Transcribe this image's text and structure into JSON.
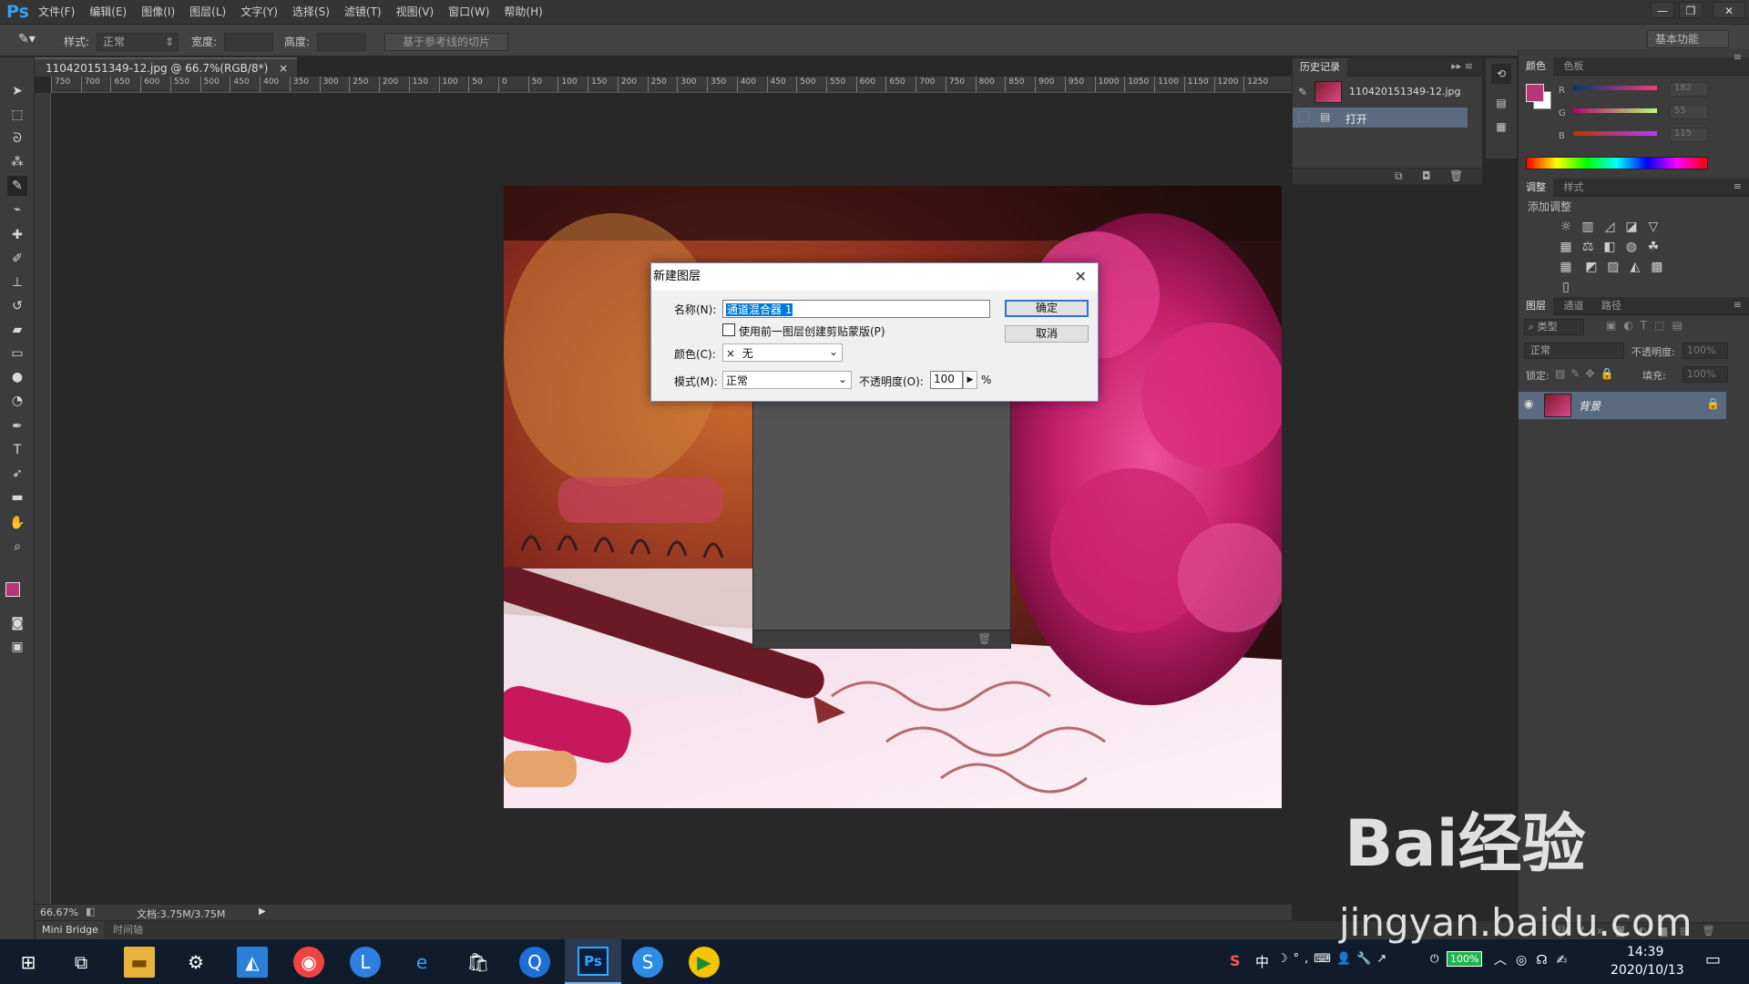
{
  "app": {
    "logo": "Ps"
  },
  "menus": [
    "文件(F)",
    "编辑(E)",
    "图像(I)",
    "图层(L)",
    "文字(Y)",
    "选择(S)",
    "滤镜(T)",
    "视图(V)",
    "窗口(W)",
    "帮助(H)"
  ],
  "window_controls": {
    "minimize": "—",
    "restore": "❐",
    "close": "✕"
  },
  "options_bar": {
    "style_label": "样式:",
    "style_value": "正常",
    "width_label": "宽度:",
    "height_label": "高度:",
    "slice_button": "基于参考线的切片",
    "workspace": "基本功能"
  },
  "document": {
    "tab_title": "110420151349-12.jpg @ 66.7%(RGB/8*)",
    "tab_close": "×",
    "zoom": "66.67%",
    "doc_size": "文档:3.75M/3.75M"
  },
  "ruler": {
    "h_ticks": [
      "750",
      "700",
      "650",
      "600",
      "550",
      "500",
      "450",
      "400",
      "350",
      "300",
      "250",
      "200",
      "150",
      "100",
      "50",
      "0",
      "50",
      "100",
      "150",
      "200",
      "250",
      "300",
      "350",
      "400",
      "450",
      "500",
      "550",
      "600",
      "650",
      "700",
      "750",
      "800",
      "850",
      "900",
      "950",
      "1000",
      "1050",
      "1100",
      "1150",
      "1200",
      "1250"
    ]
  },
  "bottom_tabs": [
    "Mini Bridge",
    "时间轴"
  ],
  "history_panel": {
    "tab": "历史记录",
    "snapshot": "110420151349-12.jpg",
    "step": "打开"
  },
  "color_panel": {
    "tabs": [
      "颜色",
      "色板"
    ],
    "channels": [
      {
        "label": "R",
        "value": "182"
      },
      {
        "label": "G",
        "value": "55"
      },
      {
        "label": "B",
        "value": "115"
      }
    ],
    "foreground": "#b63773"
  },
  "adjust_panel": {
    "tabs": [
      "调整",
      "样式"
    ],
    "add_label": "添加调整"
  },
  "layers_panel": {
    "tabs": [
      "图层",
      "通道",
      "路径"
    ],
    "filter": "类型",
    "blend": "正常",
    "opacity_label": "不透明度:",
    "opacity": "100%",
    "lock_label": "锁定:",
    "fill_label": "填充:",
    "fill": "100%",
    "layer_name": "背景"
  },
  "dialog": {
    "title": "新建图层",
    "name_label": "名称(N):",
    "name_value": "通道混合器 1",
    "clip_label": "使用前一图层创建剪贴蒙版(P)",
    "color_label": "颜色(C):",
    "color_value": "无",
    "color_x": "×",
    "mode_label": "模式(M):",
    "mode_value": "正常",
    "opacity_label": "不透明度(O):",
    "opacity_value": "100",
    "percent": "%",
    "ok": "确定",
    "cancel": "取消",
    "close": "✕"
  },
  "taskbar": {
    "ime": "中",
    "battery": "100%",
    "time": "14:39",
    "date": "2020/10/13"
  },
  "watermark": {
    "line1": "Bai经验",
    "line2": "jingyan.baidu.com"
  }
}
